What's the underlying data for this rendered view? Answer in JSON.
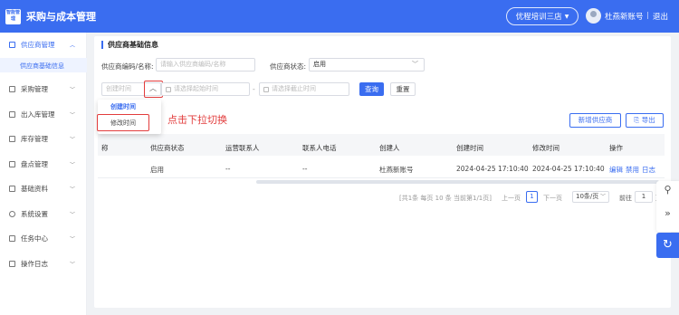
{
  "header": {
    "logo_text": "智能管理",
    "app_title": "采购与成本管理",
    "store_selector": "优程培训三店",
    "user_name": "杜燕新账号",
    "separator": "|",
    "logout": "退出"
  },
  "sidebar": {
    "items": [
      {
        "label": "供应商管理",
        "icon": "supplier-icon",
        "expanded": true
      },
      {
        "label": "采购管理",
        "icon": "cart-icon"
      },
      {
        "label": "出入库管理",
        "icon": "warehouse-icon"
      },
      {
        "label": "库存管理",
        "icon": "inventory-icon"
      },
      {
        "label": "盘点管理",
        "icon": "stocktake-icon"
      },
      {
        "label": "基础资料",
        "icon": "database-icon"
      },
      {
        "label": "系统设置",
        "icon": "gear-icon"
      },
      {
        "label": "任务中心",
        "icon": "task-icon"
      },
      {
        "label": "操作日志",
        "icon": "log-icon"
      }
    ],
    "sub_item": "供应商基础信息"
  },
  "filters": {
    "section_title": "供应商基础信息",
    "code_label": "供应商编码/名称:",
    "code_placeholder": "请输入供应商编码/名称",
    "status_label": "供应商状态:",
    "status_value": "启用",
    "time_type_placeholder": "创建时间",
    "start_placeholder": "请选择起始时间",
    "range_sep": "-",
    "end_placeholder": "请选择截止时间",
    "query_btn": "查询",
    "reset_btn": "重置"
  },
  "time_dropdown": {
    "options": [
      "创建时间",
      "修改时间"
    ],
    "selected": "创建时间"
  },
  "annotation": "点击下拉切换",
  "actions": {
    "add_btn": "新增供应商",
    "export_btn": "导出"
  },
  "table": {
    "headers": [
      "称",
      "供应商状态",
      "运营联系人",
      "联系人电话",
      "创建人",
      "创建时间",
      "修改时间",
      "操作"
    ],
    "rows": [
      {
        "status": "启用",
        "contact": "--",
        "phone": "--",
        "creator": "杜燕新账号",
        "created": "2024-04-25 17:10:40",
        "modified": "2024-04-25 17:10:40",
        "ops": [
          "编辑",
          "禁用",
          "日志"
        ]
      }
    ]
  },
  "pagination": {
    "summary": "[共1条 每页 10 条 当前第1/1页]",
    "prev": "上一页",
    "current": "1",
    "next": "下一页",
    "page_size": "10条/页",
    "goto_label": "前往",
    "goto_value": "1",
    "page_unit": "页"
  },
  "colors": {
    "primary": "#3a6df0",
    "annotation_red": "#e23c3c"
  }
}
